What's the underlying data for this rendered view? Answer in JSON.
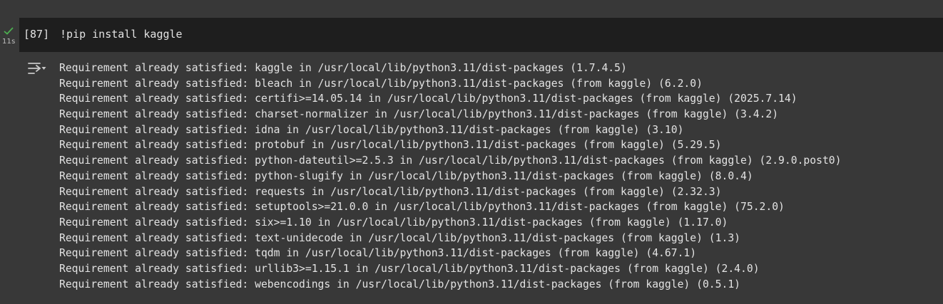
{
  "cell": {
    "execution_count": "[87]",
    "execution_time": "11s",
    "status": "success",
    "code": "!pip install kaggle"
  },
  "output": {
    "lines": [
      "Requirement already satisfied: kaggle in /usr/local/lib/python3.11/dist-packages (1.7.4.5)",
      "Requirement already satisfied: bleach in /usr/local/lib/python3.11/dist-packages (from kaggle) (6.2.0)",
      "Requirement already satisfied: certifi>=14.05.14 in /usr/local/lib/python3.11/dist-packages (from kaggle) (2025.7.14)",
      "Requirement already satisfied: charset-normalizer in /usr/local/lib/python3.11/dist-packages (from kaggle) (3.4.2)",
      "Requirement already satisfied: idna in /usr/local/lib/python3.11/dist-packages (from kaggle) (3.10)",
      "Requirement already satisfied: protobuf in /usr/local/lib/python3.11/dist-packages (from kaggle) (5.29.5)",
      "Requirement already satisfied: python-dateutil>=2.5.3 in /usr/local/lib/python3.11/dist-packages (from kaggle) (2.9.0.post0)",
      "Requirement already satisfied: python-slugify in /usr/local/lib/python3.11/dist-packages (from kaggle) (8.0.4)",
      "Requirement already satisfied: requests in /usr/local/lib/python3.11/dist-packages (from kaggle) (2.32.3)",
      "Requirement already satisfied: setuptools>=21.0.0 in /usr/local/lib/python3.11/dist-packages (from kaggle) (75.2.0)",
      "Requirement already satisfied: six>=1.10 in /usr/local/lib/python3.11/dist-packages (from kaggle) (1.17.0)",
      "Requirement already satisfied: text-unidecode in /usr/local/lib/python3.11/dist-packages (from kaggle) (1.3)",
      "Requirement already satisfied: tqdm in /usr/local/lib/python3.11/dist-packages (from kaggle) (4.67.1)",
      "Requirement already satisfied: urllib3>=1.15.1 in /usr/local/lib/python3.11/dist-packages (from kaggle) (2.4.0)",
      "Requirement already satisfied: webencodings in /usr/local/lib/python3.11/dist-packages (from kaggle) (0.5.1)"
    ]
  },
  "icons": {
    "status": "check-icon",
    "output_toggle": "output-toggle-icon"
  },
  "colors": {
    "background": "#383838",
    "code_cell": "#1e1e1e",
    "text": "#e3e3e3",
    "success": "#4caf50"
  }
}
